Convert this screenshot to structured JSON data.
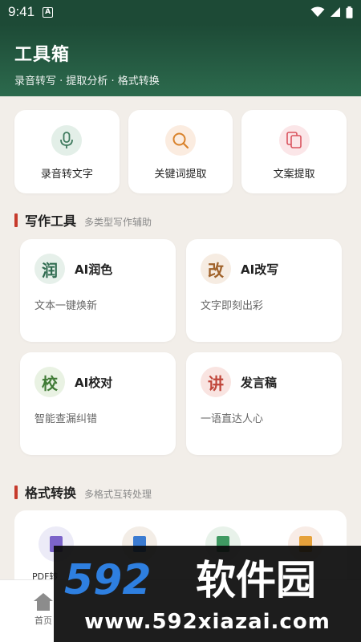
{
  "status_bar": {
    "time": "9:41",
    "notif_icon": "A"
  },
  "header": {
    "title": "工具箱",
    "subtitle": "录音转写 · 提取分析 · 格式转换"
  },
  "quick_tools": [
    {
      "label": "录音转文字",
      "icon": "microphone-icon",
      "color": "#3f7a5e"
    },
    {
      "label": "关键词提取",
      "icon": "search-icon",
      "color": "#d9822b"
    },
    {
      "label": "文案提取",
      "icon": "copy-icon",
      "color": "#d9535e"
    }
  ],
  "writing": {
    "title": "写作工具",
    "subtitle": "多类型写作辅助",
    "cards": [
      {
        "badge": "润",
        "name": "AI润色",
        "desc": "文本一键焕新",
        "color": "#2f6b50"
      },
      {
        "badge": "改",
        "name": "AI改写",
        "desc": "文字即刻出彩",
        "color": "#a0622a"
      },
      {
        "badge": "校",
        "name": "AI校对",
        "desc": "智能查漏纠错",
        "color": "#3f7a35"
      },
      {
        "badge": "讲",
        "name": "发言稿",
        "desc": "一语直达人心",
        "color": "#c0453a"
      }
    ]
  },
  "convert": {
    "title": "格式转换",
    "subtitle": "多格式互转处理",
    "items": [
      {
        "label": "PDF转",
        "color": "#7b63c9"
      },
      {
        "label": "",
        "color": "#3b7bd1"
      },
      {
        "label": "",
        "color": "#3f9a62"
      },
      {
        "label": "",
        "color": "#e6a13a"
      }
    ]
  },
  "nav": {
    "home_label": "首页"
  },
  "watermark": {
    "brand": "592软件园",
    "url": "www.592xiazai.com"
  }
}
